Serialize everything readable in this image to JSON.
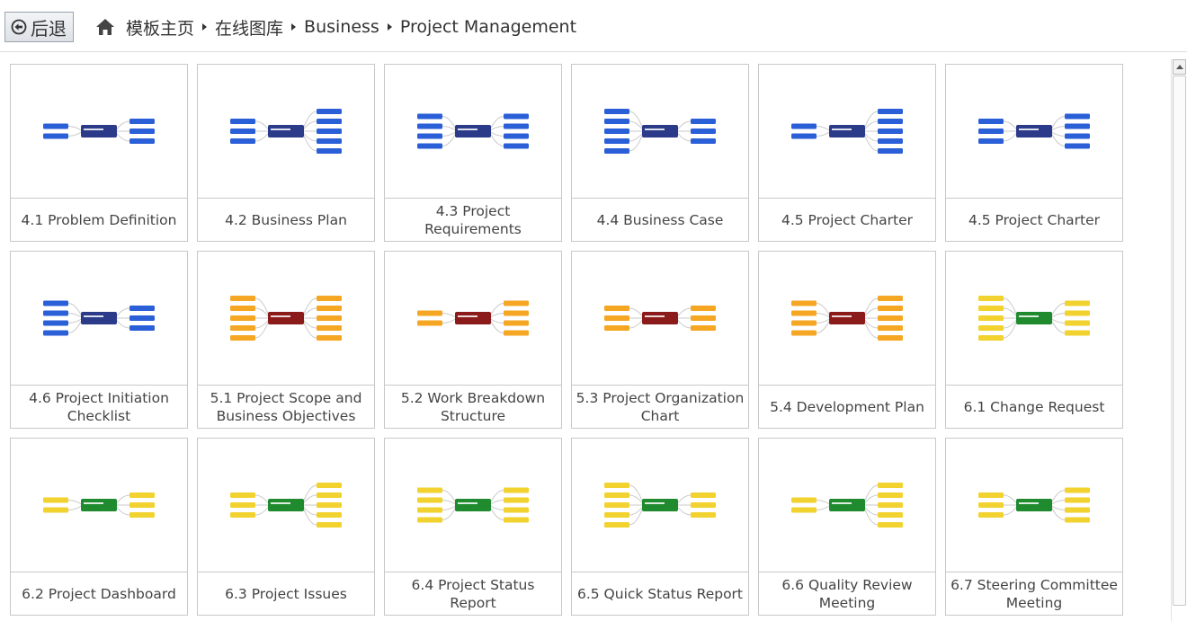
{
  "toolbar": {
    "back_label": "后退"
  },
  "breadcrumb": [
    "模板主页",
    "在线图库",
    "Business",
    "Project Management"
  ],
  "templates": [
    {
      "caption": "4.1 Problem Definition",
      "theme": "blue"
    },
    {
      "caption": "4.2 Business Plan",
      "theme": "blue"
    },
    {
      "caption": "4.3 Project Requirements",
      "theme": "blue"
    },
    {
      "caption": "4.4 Business Case",
      "theme": "blue"
    },
    {
      "caption": "4.5 Project Charter",
      "theme": "blue"
    },
    {
      "caption": "4.5 Project Charter",
      "theme": "blue"
    },
    {
      "caption": "4.6 Project Initiation Checklist",
      "theme": "blue"
    },
    {
      "caption": "5.1 Project Scope and Business Objectives",
      "theme": "orange"
    },
    {
      "caption": "5.2 Work Breakdown Structure",
      "theme": "orange"
    },
    {
      "caption": "5.3 Project Organization Chart",
      "theme": "orange"
    },
    {
      "caption": "5.4 Development Plan",
      "theme": "orange"
    },
    {
      "caption": "6.1 Change Request",
      "theme": "green"
    },
    {
      "caption": "6.2 Project Dashboard",
      "theme": "green"
    },
    {
      "caption": "6.3 Project Issues",
      "theme": "green"
    },
    {
      "caption": "6.4 Project Status Report",
      "theme": "green"
    },
    {
      "caption": "6.5 Quick Status Report",
      "theme": "green"
    },
    {
      "caption": "6.6 Quality Review Meeting",
      "theme": "green"
    },
    {
      "caption": "6.7 Steering Committee Meeting",
      "theme": "green"
    }
  ],
  "colors": {
    "blue_topic": "#2a5fd8",
    "blue_center": "#2c3a8a",
    "orange_topic": "#f5a623",
    "orange_center": "#8b1a1a",
    "green_topic": "#f2d22e",
    "green_center": "#1f8a2e"
  }
}
